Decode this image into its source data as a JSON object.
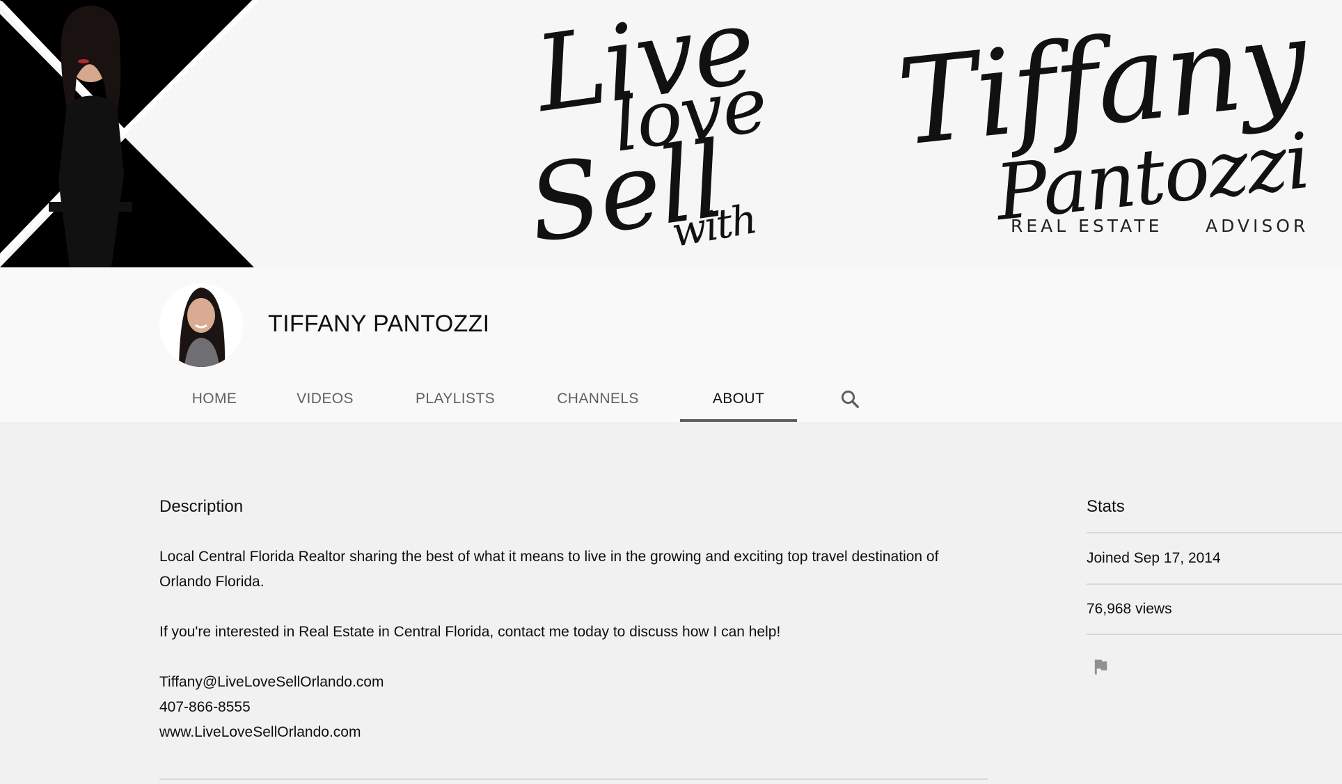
{
  "banner": {
    "script_live": "Live",
    "script_love": "love",
    "script_sell": "Sell",
    "script_with": "with",
    "script_tiffany": "Tiffany",
    "script_pantozzi": "Pantozzi",
    "sub_left": "REAL ESTATE",
    "sub_right": "ADVISOR"
  },
  "channel": {
    "name": "TIFFANY PANTOZZI"
  },
  "tabs": [
    {
      "label": "HOME"
    },
    {
      "label": "VIDEOS"
    },
    {
      "label": "PLAYLISTS"
    },
    {
      "label": "CHANNELS"
    },
    {
      "label": "ABOUT",
      "active": true
    }
  ],
  "description": {
    "heading": "Description",
    "paragraph1": "Local Central Florida Realtor sharing the best of what it means to live in the growing and exciting top travel destination of Orlando Florida.",
    "paragraph2": "If you're interested in Real Estate in Central Florida, contact me today to discuss how I can help!",
    "email": "Tiffany@LiveLoveSellOrlando.com",
    "phone": "407-866-8555",
    "website": "www.LiveLoveSellOrlando.com"
  },
  "stats": {
    "heading": "Stats",
    "joined": "Joined Sep 17, 2014",
    "views": "76,968 views"
  },
  "icons": {
    "search": "search-icon",
    "flag": "flag-icon"
  },
  "colors": {
    "page_bg": "#f1f1f1",
    "header_bg": "#f9f9f9",
    "tab_inactive": "#606060",
    "active_underline": "#606060"
  }
}
